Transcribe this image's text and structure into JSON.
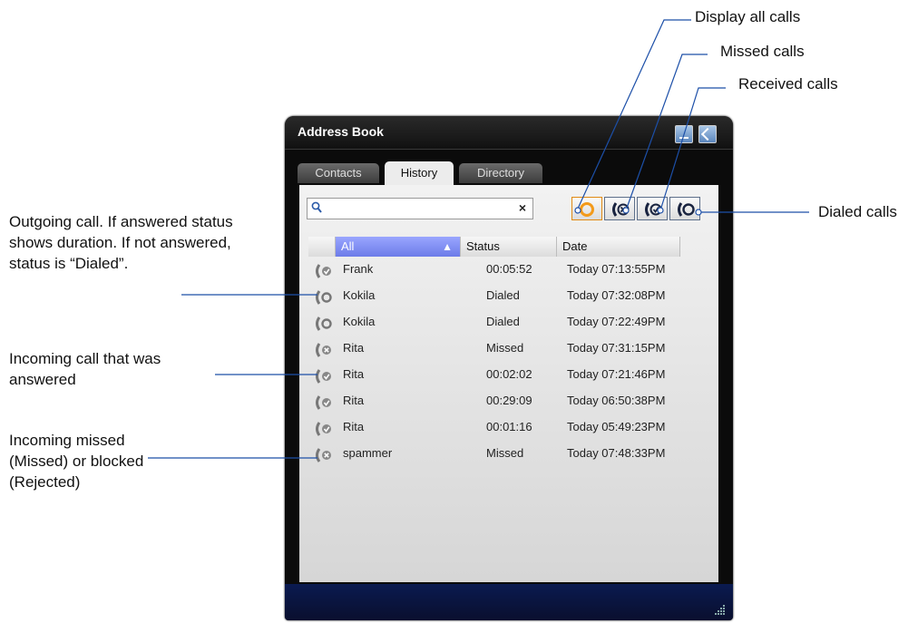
{
  "window": {
    "title": "Address Book"
  },
  "tabs": [
    "Contacts",
    "History",
    "Directory"
  ],
  "search": {
    "value": "",
    "placeholder": "",
    "clear_label": "×"
  },
  "filters": [
    {
      "icon": "display-all-calls-icon"
    },
    {
      "icon": "missed-calls-icon"
    },
    {
      "icon": "received-calls-icon"
    },
    {
      "icon": "dialed-calls-icon"
    }
  ],
  "columns": {
    "name": "All",
    "status": "Status",
    "date": "Date"
  },
  "rows": [
    {
      "icon": "received-call-icon",
      "name": "Frank",
      "status": "00:05:52",
      "date": "Today 07:13:55PM"
    },
    {
      "icon": "dialed-call-icon",
      "name": "Kokila",
      "status": "Dialed",
      "date": "Today 07:32:08PM"
    },
    {
      "icon": "dialed-call-icon",
      "name": "Kokila",
      "status": "Dialed",
      "date": "Today 07:22:49PM"
    },
    {
      "icon": "missed-call-icon",
      "name": "Rita",
      "status": "Missed",
      "date": "Today 07:31:15PM"
    },
    {
      "icon": "received-call-icon",
      "name": "Rita",
      "status": "00:02:02",
      "date": "Today 07:21:46PM"
    },
    {
      "icon": "received-call-icon",
      "name": "Rita",
      "status": "00:29:09",
      "date": "Today 06:50:38PM"
    },
    {
      "icon": "received-call-icon",
      "name": "Rita",
      "status": "00:01:16",
      "date": "Today 05:49:23PM"
    },
    {
      "icon": "missed-call-icon",
      "name": "spammer",
      "status": "Missed",
      "date": "Today 07:48:33PM"
    }
  ],
  "annotations": {
    "display_all": "Display all calls",
    "missed": "Missed calls",
    "received": "Received calls",
    "dialed": "Dialed calls",
    "outgoing": "Outgoing call. If answered status shows duration. If not answered, status is “Dialed”.",
    "incoming_answered": "Incoming call that was answered",
    "incoming_missed": "Incoming missed (Missed) or blocked (Rejected)"
  },
  "colors": {
    "leader_line": "#1c4fa8",
    "sorted_header": "#7080f0",
    "active_filter": "#f39a1a"
  }
}
